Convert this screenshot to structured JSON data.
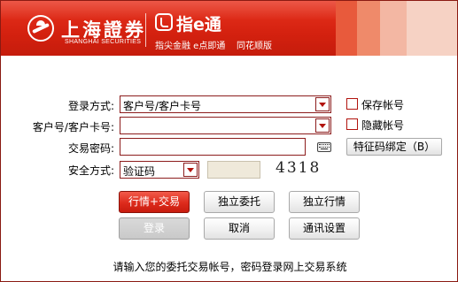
{
  "banner": {
    "brand_cn": "上海證券",
    "brand_en": "SHANGHAI SECURITIES",
    "app_name": "指e通",
    "slogan": "指尖金融 e点即通",
    "partner": "同花顺版",
    "colors": {
      "primary": "#d4210f",
      "accent_light": "#f6d2c4"
    }
  },
  "form": {
    "login_method": {
      "label": "登录方式:",
      "value": "客户号/客户卡号"
    },
    "account": {
      "label": "客户号/客户卡号:",
      "value": ""
    },
    "password": {
      "label": "交易密码:",
      "value": ""
    },
    "security": {
      "label": "安全方式:",
      "value": "验证码",
      "code_value": "",
      "captcha": "4318"
    }
  },
  "options": {
    "save_account": {
      "label": "保存帐号",
      "checked": false
    },
    "hide_account": {
      "label": "隐藏帐号",
      "checked": false
    }
  },
  "buttons": {
    "bind_feature_code": "特征码绑定（B）",
    "market_trade": "行情+交易",
    "standalone_order": "独立委托",
    "standalone_market": "独立行情",
    "login": "登录",
    "cancel": "取消",
    "comm_settings": "通讯设置"
  },
  "footer": {
    "note": "请输入您的委托交易帐号，密码登录网上交易系统"
  },
  "icons": [
    "logo-icon",
    "app-icon",
    "dropdown-arrow-icon",
    "keyboard-icon"
  ]
}
